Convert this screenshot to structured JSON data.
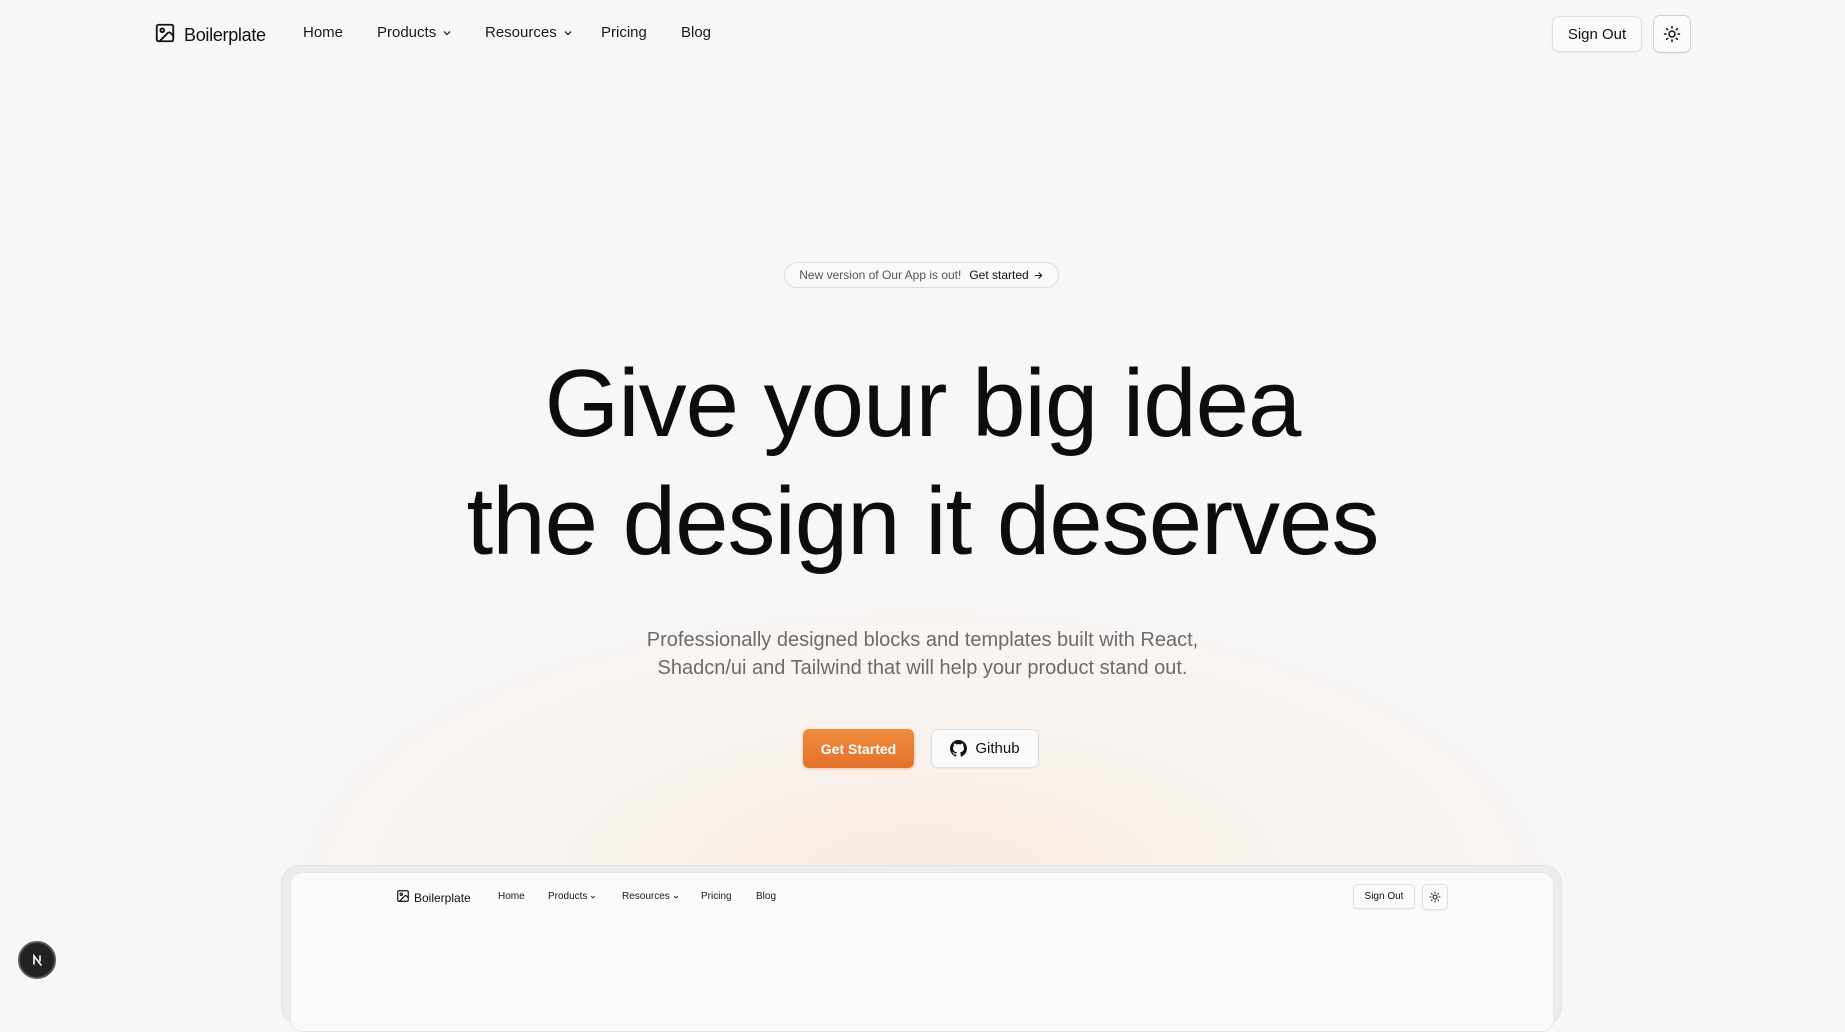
{
  "header": {
    "brand": "Boilerplate",
    "nav": [
      {
        "label": "Home"
      },
      {
        "label": "Products"
      },
      {
        "label": "Resources"
      },
      {
        "label": "Pricing"
      },
      {
        "label": "Blog"
      }
    ],
    "sign_out": "Sign Out",
    "theme_icon": "sun-icon"
  },
  "announcement": {
    "text": "New version of Our App is out!",
    "cta": "Get started"
  },
  "hero": {
    "title_line1": "Give your big idea",
    "title_line2": "the design it deserves",
    "subtitle_line1": "Professionally designed blocks and templates built with React,",
    "subtitle_line2": "Shadcn/ui and Tailwind that will help your product stand out.",
    "primary_cta": "Get Started",
    "secondary_cta": "Github"
  },
  "preview": {
    "brand": "Boilerplate",
    "nav": [
      {
        "label": "Home"
      },
      {
        "label": "Products"
      },
      {
        "label": "Resources"
      },
      {
        "label": "Pricing"
      },
      {
        "label": "Blog"
      }
    ],
    "sign_out": "Sign Out"
  },
  "colors": {
    "accent": "#ec7c33",
    "background": "#f7f7f7",
    "muted_text": "#6b6b6b"
  }
}
